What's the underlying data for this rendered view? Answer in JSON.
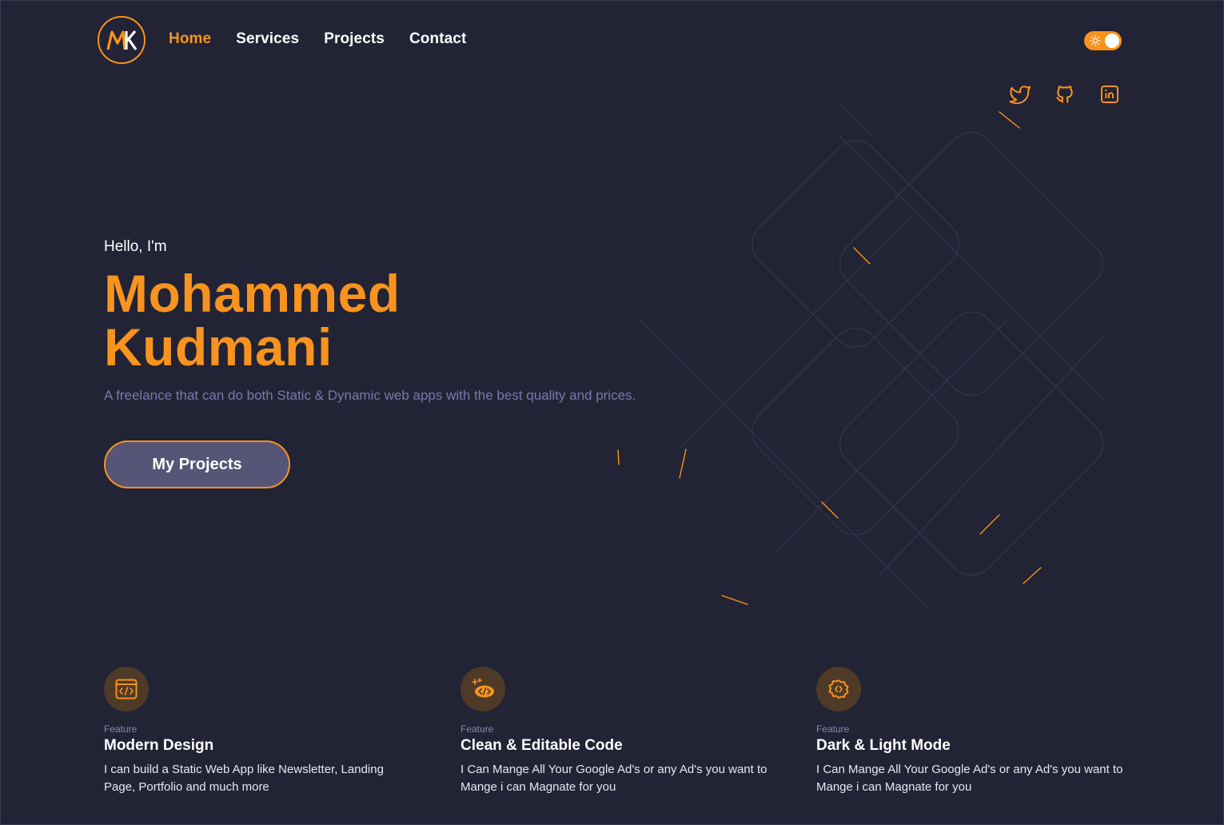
{
  "nav": {
    "logo_text": "MK",
    "links": [
      {
        "label": "Home",
        "active": true
      },
      {
        "label": "Services",
        "active": false
      },
      {
        "label": "Projects",
        "active": false
      },
      {
        "label": "Contact",
        "active": false
      }
    ]
  },
  "theme_toggle": {
    "icon": "sun-icon",
    "state": "on"
  },
  "socials": [
    {
      "icon": "twitter-icon"
    },
    {
      "icon": "github-icon"
    },
    {
      "icon": "linkedin-icon"
    }
  ],
  "hero": {
    "greeting": "Hello, I'm",
    "first_name": "Mohammed",
    "last_name": "Kudmani",
    "tagline": "A freelance that can do both Static & Dynamic web apps with the best quality and prices.",
    "cta_label": "My Projects"
  },
  "features": [
    {
      "icon": "code-window-icon",
      "kicker": "Feature",
      "title": "Modern Design",
      "description": "I can build a Static Web App like Newsletter, Landing Page, Portfolio and much more"
    },
    {
      "icon": "sparkle-code-icon",
      "kicker": "Feature",
      "title": "Clean & Editable Code",
      "description": "I Can Mange All Your Google Ad's or any Ad's you want to Mange i can Magnate for you"
    },
    {
      "icon": "gear-code-icon",
      "kicker": "Feature",
      "title": "Dark & Light Mode",
      "description": "I Can Mange All Your Google Ad's or any Ad's you want to Mange i can Magnate for you"
    }
  ],
  "colors": {
    "background": "#222334",
    "accent": "#f7931e",
    "muted_text": "#7a78ad",
    "button_fill": "#565578"
  }
}
